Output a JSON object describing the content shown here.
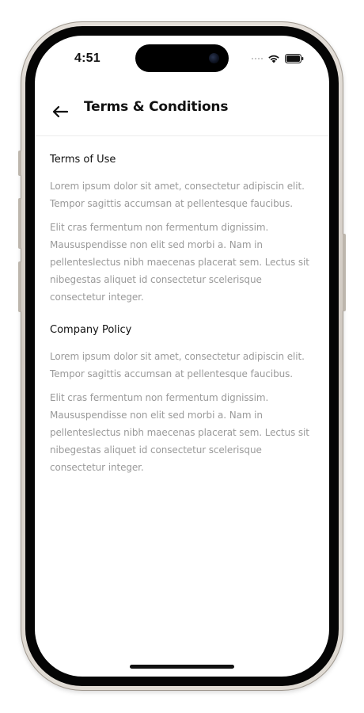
{
  "status_bar": {
    "time": "4:51",
    "icons": [
      "signal-dots-icon",
      "wifi-icon",
      "battery-icon"
    ]
  },
  "header": {
    "back_icon": "arrow-left-icon",
    "title": "Terms & Conditions"
  },
  "sections": [
    {
      "title": "Terms of Use",
      "paragraphs": [
        "Lorem ipsum dolor sit amet, consectetur adipiscin elit. Tempor sagittis accumsan at pellentesque faucibus.",
        "Elit cras fermentum non fermentum dignissim. Maususpendisse non elit sed morbi a. Nam in pellenteslectus nibh maecenas placerat sem. Lectus sit nibegestas aliquet id consectetur scelerisque consectetur integer."
      ]
    },
    {
      "title": "Company Policy",
      "paragraphs": [
        "Lorem ipsum dolor sit amet, consectetur adipiscin elit. Tempor sagittis accumsan at pellentesque faucibus.",
        "Elit cras fermentum non fermentum dignissim. Maususpendisse non elit sed morbi a. Nam in pellenteslectus nibh maecenas placerat sem. Lectus sit nibegestas aliquet id consectetur scelerisque consectetur integer."
      ]
    }
  ],
  "colors": {
    "text_primary": "#111111",
    "text_secondary": "#9a9a9a",
    "divider": "#ececec",
    "background": "#ffffff"
  }
}
